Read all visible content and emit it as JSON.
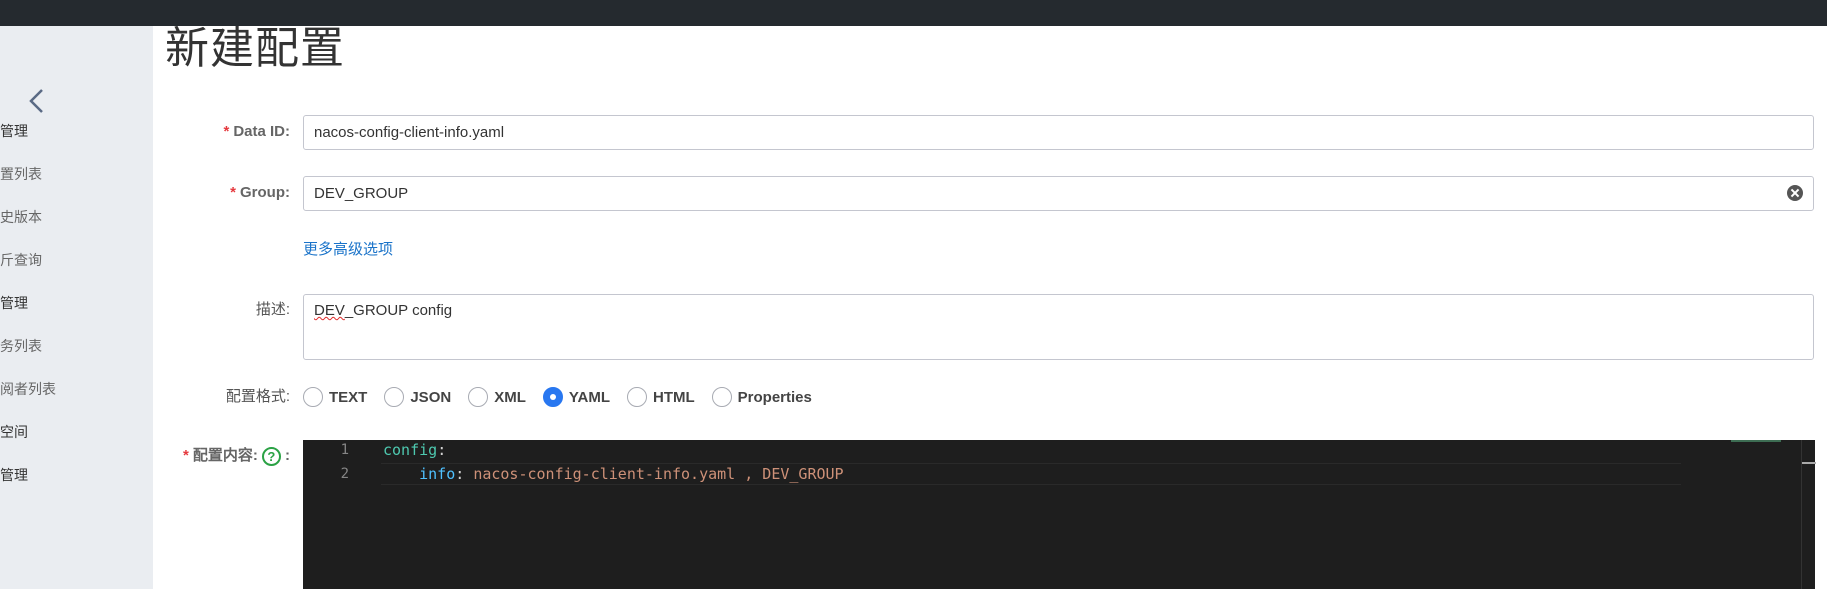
{
  "page": {
    "title": "新建配置"
  },
  "sidebar": {
    "items": [
      {
        "label": "管理"
      },
      {
        "label": "置列表"
      },
      {
        "label": "史版本"
      },
      {
        "label": "斤查询"
      },
      {
        "label": "管理"
      },
      {
        "label": "务列表"
      },
      {
        "label": "阅者列表"
      },
      {
        "label": "空间"
      },
      {
        "label": "管理"
      }
    ]
  },
  "form": {
    "data_id": {
      "label": "Data ID:",
      "value": "nacos-config-client-info.yaml"
    },
    "group": {
      "label": "Group:",
      "value": "DEV_GROUP"
    },
    "advanced_link": "更多高级选项",
    "description": {
      "label": "描述:",
      "value_prefix": "DEV",
      "value_rest": "_GROUP config"
    },
    "format": {
      "label": "配置格式:",
      "options": [
        {
          "label": "TEXT",
          "checked": false
        },
        {
          "label": "JSON",
          "checked": false
        },
        {
          "label": "XML",
          "checked": false
        },
        {
          "label": "YAML",
          "checked": true
        },
        {
          "label": "HTML",
          "checked": false
        },
        {
          "label": "Properties",
          "checked": false
        }
      ]
    },
    "content": {
      "label": "配置内容:",
      "help": "?",
      "colon": ":",
      "lines": [
        {
          "num": "1",
          "key": "config",
          "sep": ":",
          "value": ""
        },
        {
          "num": "2",
          "indent": "    ",
          "key": "info",
          "sep": ": ",
          "value": "nacos-config-client-info.yaml , DEV_GROUP"
        }
      ]
    },
    "required_mark": "*"
  },
  "colors": {
    "topbar": "#252a2f",
    "sidebar": "#eaedf1",
    "accent": "#2877f0",
    "link": "#1a73c9",
    "required": "#e5393e",
    "editor_bg": "#1e1e1e"
  }
}
